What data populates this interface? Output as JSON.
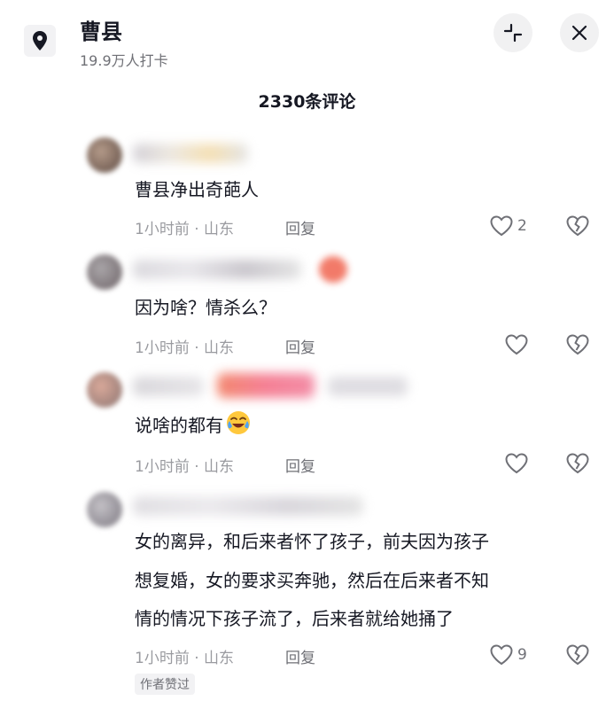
{
  "header": {
    "title": "曹县",
    "subtitle": "19.9万人打卡"
  },
  "comment_count": "2330条评论",
  "comments": [
    {
      "text": "曹县净出奇葩人",
      "meta": "1小时前 · 山东",
      "reply": "回复",
      "likes": "2"
    },
    {
      "text": "因为啥？情杀么？",
      "meta": "1小时前 · 山东",
      "reply": "回复",
      "likes": ""
    },
    {
      "text": "说啥的都有",
      "emoji": "crying-laughing-emoji",
      "meta": "1小时前 · 山东",
      "reply": "回复",
      "likes": ""
    },
    {
      "lines": [
        "女的离异，和后来者怀了孩子，前夫因为孩子",
        "想复婚，女的要求买奔驰，然后在后来者不知",
        "情的情况下孩子流了，后来者就给她捅了"
      ],
      "meta": "1小时前 · 山东",
      "reply": "回复",
      "likes": "9",
      "badge": "作者赞过"
    }
  ]
}
